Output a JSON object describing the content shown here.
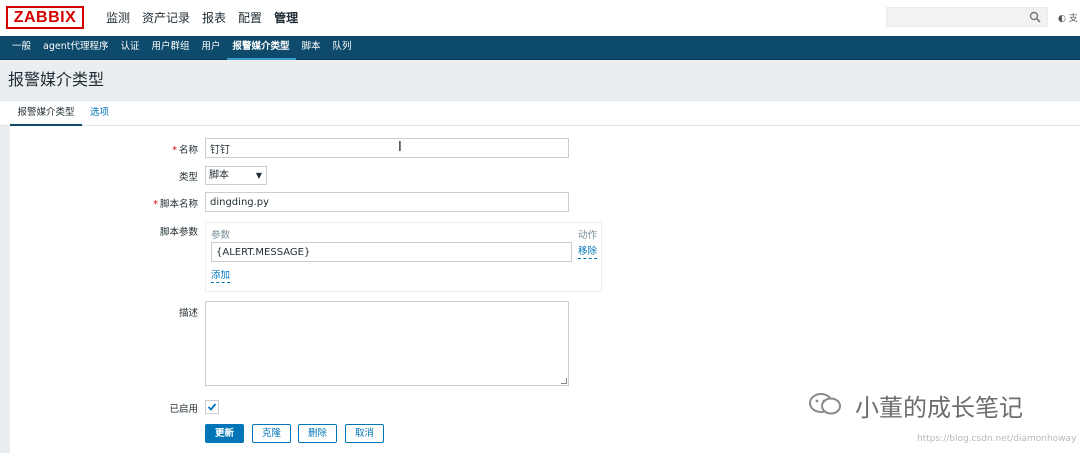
{
  "app": {
    "logo": "ZABBIX",
    "main_menu": [
      "监测",
      "资产记录",
      "报表",
      "配置",
      "管理"
    ],
    "main_menu_active": "管理",
    "search": {
      "value": "",
      "placeholder": ""
    },
    "support_label": "支"
  },
  "sub_menu": {
    "items": [
      "一般",
      "agent代理程序",
      "认证",
      "用户群组",
      "用户",
      "报警媒介类型",
      "脚本",
      "队列"
    ],
    "active": "报警媒介类型"
  },
  "page": {
    "title": "报警媒介类型"
  },
  "tabs": [
    {
      "label": "报警媒介类型",
      "active": true
    },
    {
      "label": "选项",
      "active": false
    }
  ],
  "form": {
    "name": {
      "label": "名称",
      "value": "钉钉",
      "required": true
    },
    "type": {
      "label": "类型",
      "value": "脚本"
    },
    "script_name": {
      "label": "脚本名称",
      "value": "dingding.py",
      "required": true
    },
    "script_params": {
      "label": "脚本参数",
      "col_param": "参数",
      "col_action": "动作",
      "rows": [
        {
          "value": "{ALERT.MESSAGE}",
          "remove_label": "移除"
        }
      ],
      "add_label": "添加"
    },
    "description": {
      "label": "描述",
      "value": ""
    },
    "enabled": {
      "label": "已启用",
      "checked": true
    }
  },
  "buttons": {
    "update": "更新",
    "clone": "克隆",
    "delete": "删除",
    "cancel": "取消"
  },
  "watermark": {
    "text": "小董的成长笔记",
    "url": "https://blog.csdn.net/diamonhoway"
  },
  "colors": {
    "brand_red": "#d40000",
    "nav_dark": "#0e4a6b",
    "link_blue": "#0275b8"
  }
}
